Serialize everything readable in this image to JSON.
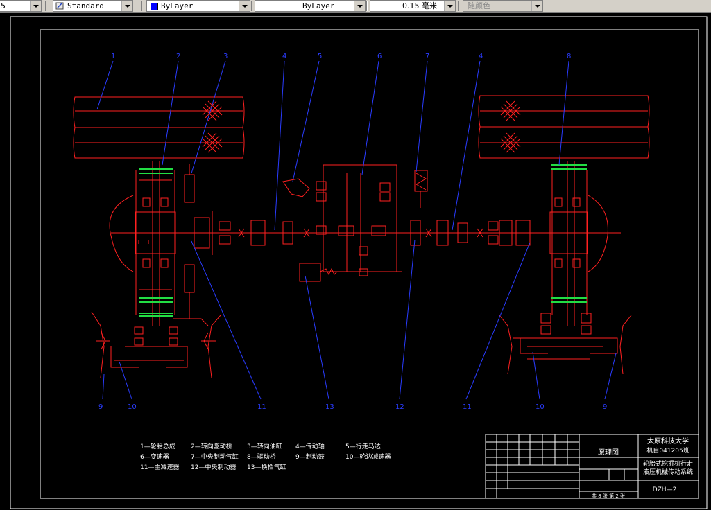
{
  "toolbar": {
    "prev_value": "5",
    "text_style": "Standard",
    "layer_color_name": "ByLayer",
    "linetype": "ByLayer",
    "lineweight": "0.15 毫米",
    "plot_style": "随颜色"
  },
  "colors": {
    "background": "#000000",
    "drawing": "#ff2020",
    "leader": "#2a3cff",
    "frame": "#ffffff",
    "green": "#22dd44"
  },
  "callouts": {
    "top": [
      "1",
      "2",
      "3",
      "4",
      "5",
      "6",
      "7",
      "4",
      "8"
    ],
    "bottom": [
      "9",
      "10",
      "11",
      "13",
      "12",
      "11",
      "10",
      "9"
    ]
  },
  "legend": [
    [
      "1—轮胎总成",
      "2—转向驱动桥",
      "3—转向油缸",
      "4—传动轴",
      "5—行走马达"
    ],
    [
      "6—变速器",
      "7—中央制动气缸",
      "8—驱动桥",
      "9—制动鼓",
      "10—轮边减速器"
    ],
    [
      "11—主减速器",
      "12—中央制动器",
      "13—换档气缸"
    ]
  ],
  "title_block": {
    "drawing_name": "原理图",
    "school": "太原科技大学",
    "class": "机自041205班",
    "title": "轮胎式挖掘机行走液压机械传动系统",
    "code": "DZH—2",
    "sheet": "共 8 张  第 2 张"
  }
}
